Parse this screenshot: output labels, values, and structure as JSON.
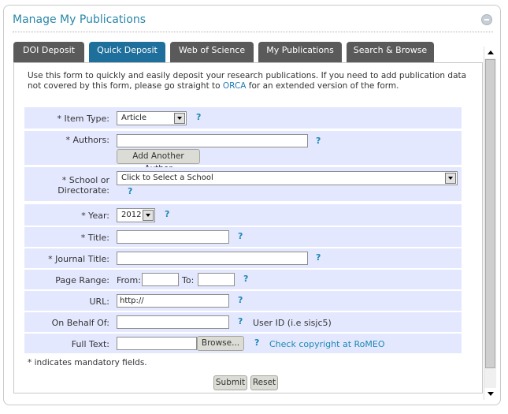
{
  "panel": {
    "title": "Manage My Publications"
  },
  "tabs": [
    {
      "label": "DOI Deposit",
      "active": false
    },
    {
      "label": "Quick Deposit",
      "active": true
    },
    {
      "label": "Web of Science",
      "active": false
    },
    {
      "label": "My Publications",
      "active": false
    },
    {
      "label": "Search & Browse",
      "active": false
    }
  ],
  "intro": {
    "text_before": "Use this form to quickly and easily deposit your research publications. If you need to add publication data not covered by this form, please go straight to ",
    "link": "ORCA",
    "text_after": " for an extended version of the form."
  },
  "form": {
    "help_glyph": "?",
    "item_type": {
      "label": "* Item Type:",
      "value": "Article"
    },
    "authors": {
      "label": "* Authors:",
      "value": "",
      "add_button": "Add Another Author"
    },
    "school": {
      "label_line1": "* School or",
      "label_line2": "Directorate:",
      "value": "Click to Select a School"
    },
    "year": {
      "label": "* Year:",
      "value": "2012"
    },
    "title": {
      "label": "* Title:",
      "value": ""
    },
    "journal_title": {
      "label": "* Journal Title:",
      "value": ""
    },
    "page_range": {
      "label": "Page Range:",
      "from_label": "From:",
      "to_label": "To:",
      "from_value": "",
      "to_value": ""
    },
    "url": {
      "label": "URL:",
      "value": "http://"
    },
    "on_behalf_of": {
      "label": "On Behalf Of:",
      "value": "",
      "hint": "User ID (i.e sisjc5)"
    },
    "full_text": {
      "label": "Full Text:",
      "browse_button": "Browse...",
      "copyright_link": "Check copyright at RoMEO"
    }
  },
  "mandatory_note": "* indicates mandatory fields.",
  "buttons": {
    "submit": "Submit",
    "reset": "Reset"
  }
}
